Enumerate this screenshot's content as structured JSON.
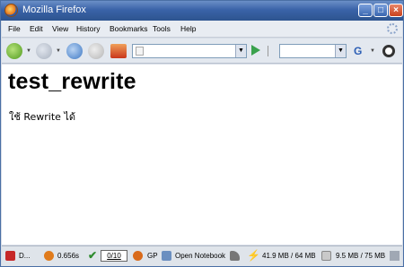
{
  "window": {
    "title": "Mozilla Firefox"
  },
  "menu": [
    "File",
    "Edit",
    "View",
    "History",
    "Bookmarks",
    "Tools",
    "Help"
  ],
  "page": {
    "heading": "test_rewrite",
    "body_text": "ใช้ Rewrite ได้"
  },
  "status": {
    "done_label": "D...",
    "load_time": "0.656s",
    "validator_count": "0/10",
    "gp_label": "GP",
    "notebook_label": "Open Notebook",
    "memory_1": "41.9 MB / 64 MB",
    "memory_2": "9.5 MB / 75 MB"
  },
  "colors": {
    "titlebar": "#3a63a8",
    "go_arrow": "#39a14c",
    "back_arrow": "#4f9a1e"
  }
}
